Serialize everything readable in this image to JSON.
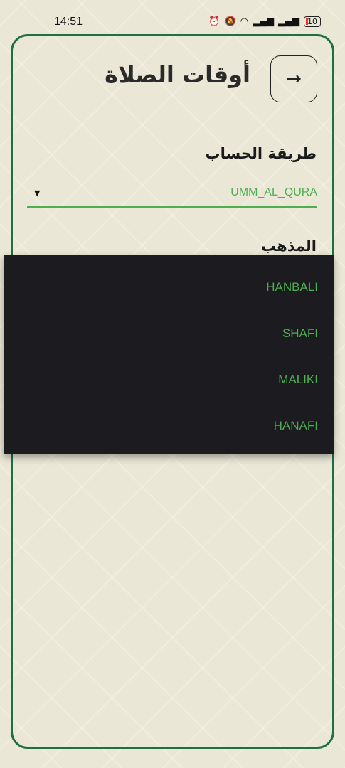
{
  "status_bar": {
    "time": "14:51",
    "battery": "10"
  },
  "header": {
    "title": "أوقات الصلاة",
    "back_icon": "arrow-right-icon"
  },
  "calculation": {
    "label": "طريقة الحساب",
    "value": "UMM_AL_QURA"
  },
  "madhab": {
    "label": "المذهب",
    "options": [
      "HANBALI",
      "SHAFI",
      "MALIKI",
      "HANAFI"
    ]
  },
  "colors": {
    "accent": "#4caf50",
    "border": "#1f6e45",
    "menu_bg": "#1c1b1f"
  }
}
